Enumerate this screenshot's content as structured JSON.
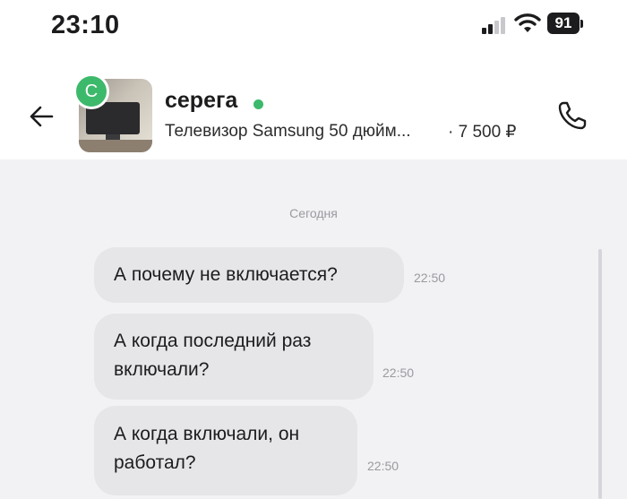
{
  "status_bar": {
    "time": "23:10",
    "battery": "91",
    "icons": [
      "signal-icon",
      "wifi-icon",
      "battery-icon"
    ]
  },
  "header": {
    "back_icon": "back-arrow-icon",
    "avatar_letter": "С",
    "contact_name": "серега",
    "online": true,
    "listing_title": "Телевизор Samsung 50 дюйм...",
    "listing_price": "· 7 500 ₽",
    "call_icon": "phone-icon"
  },
  "chat": {
    "date_label": "Сегодня",
    "messages": [
      {
        "lines": [
          "А почему не включается?"
        ],
        "time": "22:50"
      },
      {
        "lines": [
          "А когда последний раз",
          "включали?"
        ],
        "time": "22:50"
      },
      {
        "lines": [
          "А когда включали, он",
          "работал?"
        ],
        "time": "22:50"
      }
    ]
  },
  "colors": {
    "online_green": "#3db96b",
    "bubble_bg": "#e6e6e9",
    "chat_bg": "#f2f2f4"
  }
}
